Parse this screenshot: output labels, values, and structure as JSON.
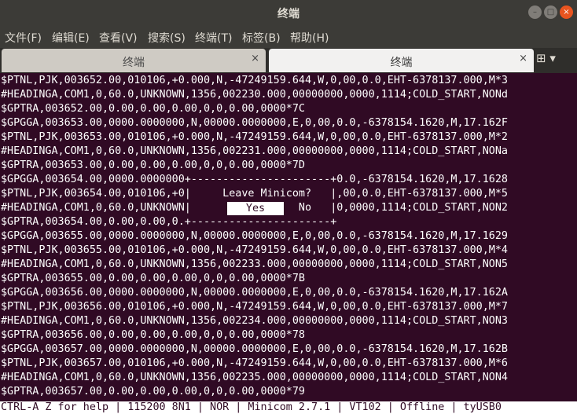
{
  "window": {
    "title": "终端",
    "buttons": {
      "minimize": "–",
      "maximize": "□",
      "close": "×"
    }
  },
  "menu": [
    "文件(F)",
    "编辑(E)",
    "查看(V)",
    "搜索(S)",
    "终端(T)",
    "标签(B)",
    "帮助(H)"
  ],
  "tabs": [
    {
      "label": "终端",
      "active": false,
      "close": "×"
    },
    {
      "label": "终端",
      "active": true,
      "close": "×"
    }
  ],
  "new_tab_icon": "new-tab-icon",
  "new_tab_glyph": "⊞ ▾",
  "terminal": {
    "lines": [
      "$PTNL,PJK,003652.00,010106,+0.000,N,-47249159.644,W,0,00,0.0,EHT-6378137.000,M*3",
      "#HEADINGA,COM1,0,60.0,UNKNOWN,1356,002230.000,00000000,0000,1114;COLD_START,NONd",
      "$GPTRA,003652.00,0.00,0.00,0.00,0,0,0.00,0000*7C",
      "$GPGGA,003653.00,0000.0000000,N,00000.0000000,E,0,00,0.0,-6378154.1620,M,17.162F",
      "$PTNL,PJK,003653.00,010106,+0.000,N,-47249159.644,W,0,00,0.0,EHT-6378137.000,M*2",
      "#HEADINGA,COM1,0,60.0,UNKNOWN,1356,002231.000,00000000,0000,1114;COLD_START,NONa",
      "$GPTRA,003653.00,0.00,0.00,0.00,0,0,0.00,0000*7D",
      "$GPGGA,003654.00,0000.0000000+----------------------+0.0,-6378154.1620,M,17.1628",
      "$PTNL,PJK,003654.00,010106,+0|     Leave Minicom?   |,00,0.0,EHT-6378137.000,M*5",
      "#HEADINGA,COM1,0,60.0,UNKNOWN|                 No   |0,0000,1114;COLD_START,NON2",
      "$GPTRA,003654.00,0.00,0.00,0.+----------------------+",
      "$GPGGA,003655.00,0000.0000000,N,00000.0000000,E,0,00,0.0,-6378154.1620,M,17.1629",
      "$PTNL,PJK,003655.00,010106,+0.000,N,-47249159.644,W,0,00,0.0,EHT-6378137.000,M*4",
      "#HEADINGA,COM1,0,60.0,UNKNOWN,1356,002233.000,00000000,0000,1114;COLD_START,NON5",
      "$GPTRA,003655.00,0.00,0.00,0.00,0,0,0.00,0000*7B",
      "$GPGGA,003656.00,0000.0000000,N,00000.0000000,E,0,00,0.0,-6378154.1620,M,17.162A",
      "$PTNL,PJK,003656.00,010106,+0.000,N,-47249159.644,W,0,00,0.0,EHT-6378137.000,M*7",
      "#HEADINGA,COM1,0,60.0,UNKNOWN,1356,002234.000,00000000,0000,1114;COLD_START,NON3",
      "$GPTRA,003656.00,0.00,0.00,0.00,0,0,0.00,0000*78",
      "$GPGGA,003657.00,0000.0000000,N,00000.0000000,E,0,00,0.0,-6378154.1620,M,17.162B",
      "$PTNL,PJK,003657.00,010106,+0.000,N,-47249159.644,W,0,00,0.0,EHT-6378137.000,M*6",
      "#HEADINGA,COM1,0,60.0,UNKNOWN,1356,002235.000,00000000,0000,1114;COLD_START,NON4",
      "$GPTRA,003657.00,0.00,0.00,0.00,0,0,0.00,0000*79"
    ],
    "dialog": {
      "title": "Leave Minicom?",
      "yes": "Yes",
      "no": "No",
      "selected": "Yes"
    }
  },
  "status_line": "CTRL-A Z for help | 115200 8N1 | NOR | Minicom 2.7.1 | VT102 | Offline | tyUSB0",
  "colors": {
    "terminal_bg": "#300a24",
    "text": "#ffffff",
    "titlebar": "#3c3b37",
    "close_button": "#e9541f"
  }
}
